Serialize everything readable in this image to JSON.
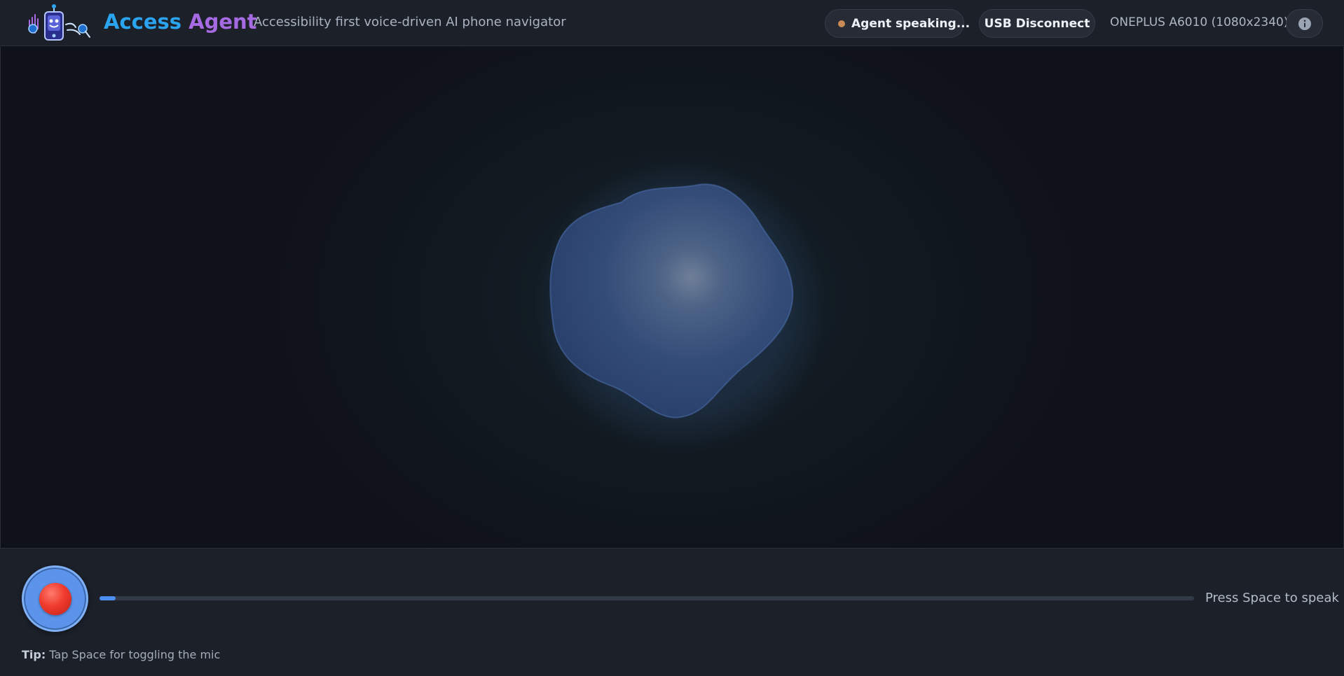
{
  "header": {
    "brand_first": "Access",
    "brand_second": "Agent",
    "tagline": "Accessibility first voice-driven AI phone navigator",
    "status_label": "Agent speaking...",
    "usb_button_label": "USB Disconnect",
    "device_label": "ONEPLUS A6010 (1080x2340)",
    "info_icon": "info-icon"
  },
  "controls": {
    "mic_icon": "record-icon",
    "audio_level": 0.015,
    "hint": "Press Space to speak",
    "tip_label": "Tip:",
    "tip_text": "Tap Space for toggling the mic"
  },
  "colors": {
    "brand_blue": "#2ba4ef",
    "brand_purple": "#a66ae3",
    "status_dot": "#c98a56",
    "accent": "#4d8ff0",
    "record": "#ef3b2d"
  }
}
